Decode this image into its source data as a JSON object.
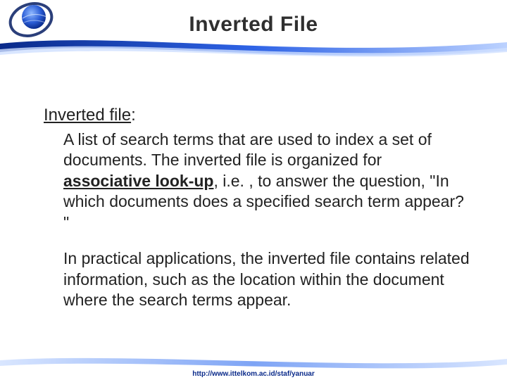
{
  "title": "Inverted File",
  "heading": "Inverted file",
  "heading_suffix": ":",
  "para1_a": "A list of search terms that are used to index a set of documents.  The inverted file is organized for ",
  "para1_bold": "associative look-up",
  "para1_b": ", i.e. , to answer the question, \"In which documents does a specified search term appear? \"",
  "para2": "In practical applications, the inverted file contains related information, such as the location within the document where the search terms appear.",
  "footer": "http://www.ittelkom.ac.id/staf/yanuar"
}
